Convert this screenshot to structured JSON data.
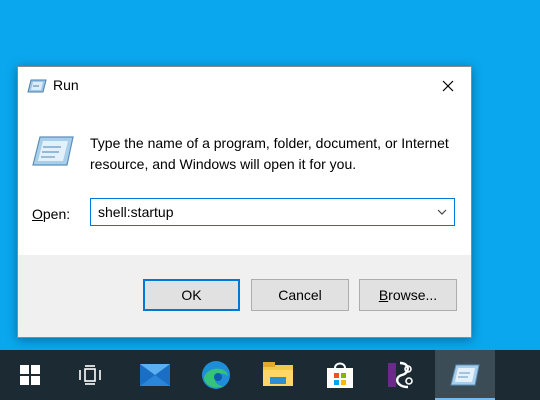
{
  "dialog": {
    "title": "Run",
    "close_label": "Close",
    "description": "Type the name of a program, folder, document, or Internet resource, and Windows will open it for you.",
    "open_label_accel": "O",
    "open_label_rest": "pen:",
    "open_value": "shell:startup",
    "buttons": {
      "ok": "OK",
      "cancel": "Cancel",
      "browse_accel": "B",
      "browse_rest": "rowse..."
    }
  },
  "taskbar": {
    "items": [
      {
        "icon": "windows-start-icon"
      },
      {
        "icon": "task-view-icon"
      },
      {
        "icon": "mail-icon"
      },
      {
        "icon": "edge-icon"
      },
      {
        "icon": "file-explorer-icon"
      },
      {
        "icon": "store-icon"
      },
      {
        "icon": "app-icon"
      },
      {
        "icon": "run-app-icon",
        "active": true
      }
    ]
  },
  "colors": {
    "desktop": "#0aa7ee",
    "accent": "#0078d7",
    "taskbar": "#1c2a33"
  }
}
